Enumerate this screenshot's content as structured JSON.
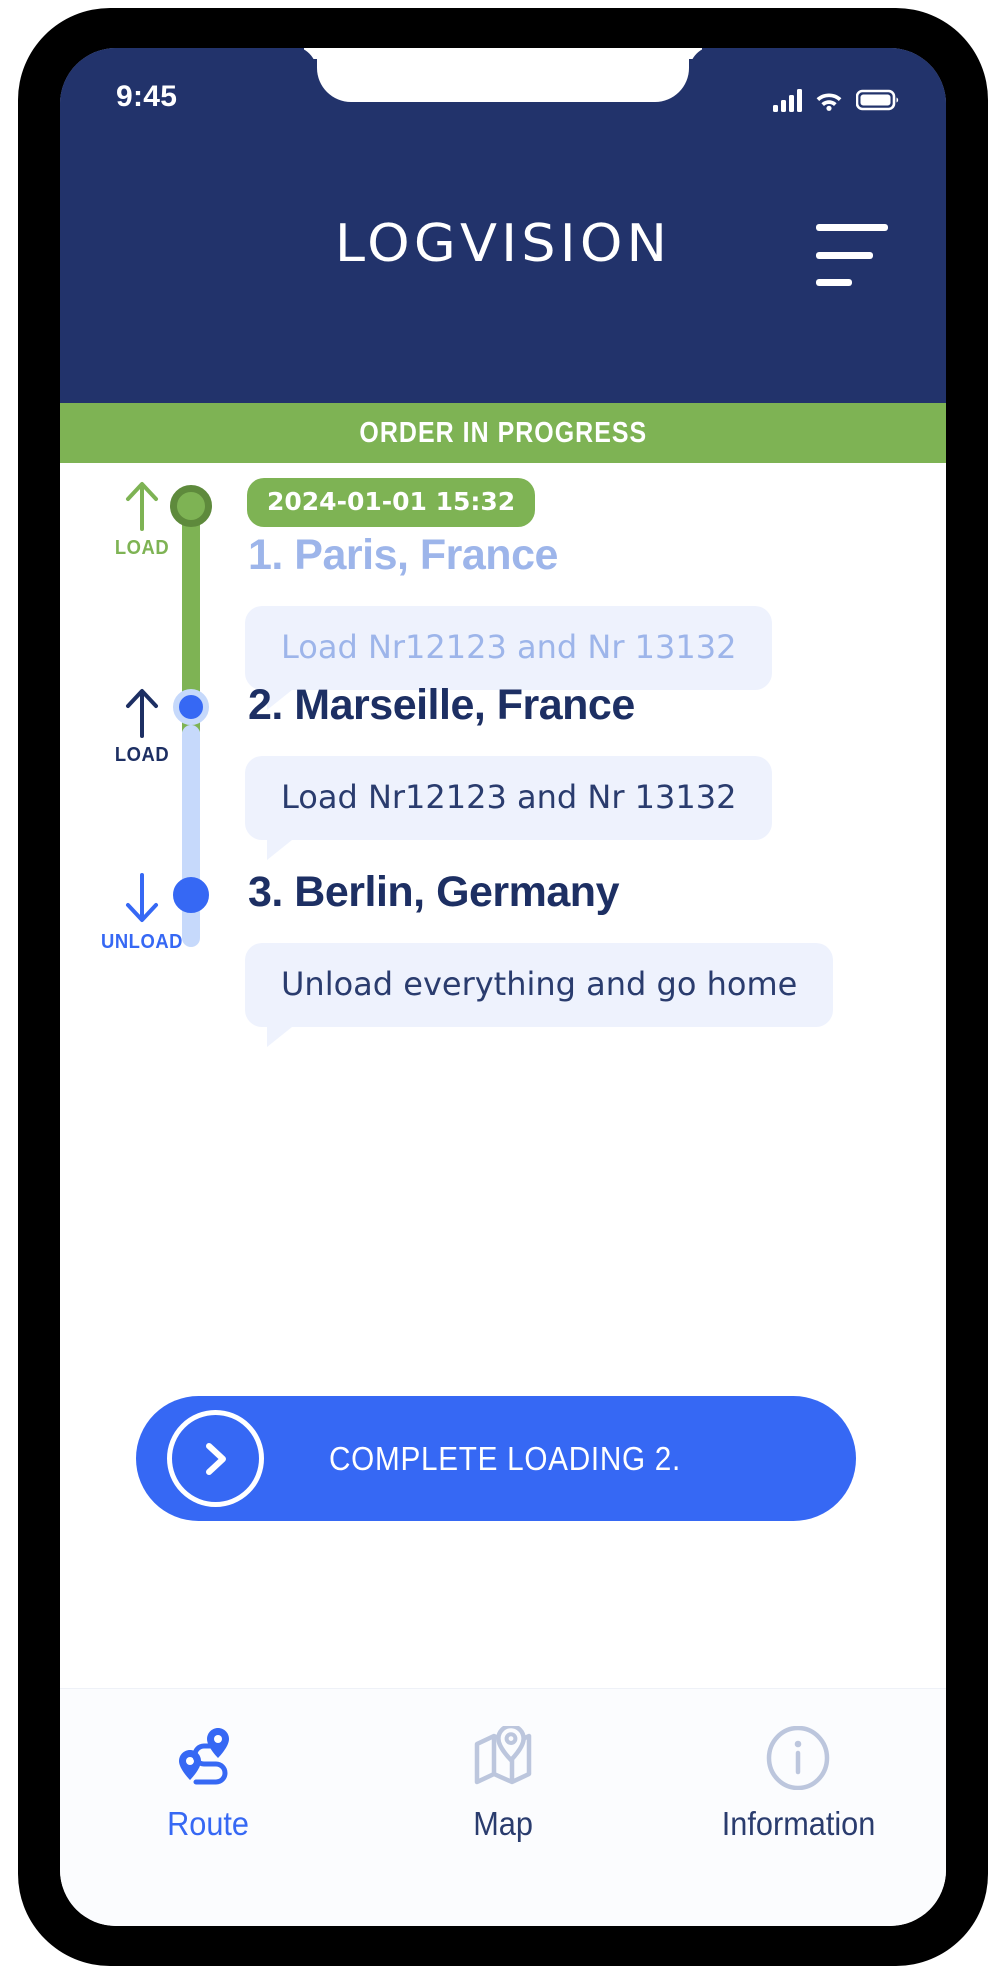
{
  "status_bar": {
    "time": "9:45",
    "signal_icon": "signal-bars-icon",
    "wifi_icon": "wifi-icon",
    "battery_icon": "battery-icon"
  },
  "header": {
    "brand": "LOGVISION",
    "menu_icon": "hamburger-menu-icon",
    "background_color": "#22336b"
  },
  "status_banner": {
    "text": "ORDER IN PROGRESS",
    "color": "#7eb354"
  },
  "timeline": {
    "stops": [
      {
        "index": "1.",
        "title": "1. Paris, France",
        "action": "LOAD",
        "action_icon": "arrow-up-icon",
        "timestamp": "2024-01-01  15:32",
        "note": "Load Nr12123 and Nr 13132",
        "state": "completed",
        "accent_color": "#7eb354"
      },
      {
        "index": "2.",
        "title": "2. Marseille, France",
        "action": "LOAD",
        "action_icon": "arrow-up-icon",
        "note": "Load Nr12123 and Nr 13132",
        "state": "active",
        "accent_color": "#3668f4"
      },
      {
        "index": "3.",
        "title": "3. Berlin, Germany",
        "action": "UNLOAD",
        "action_icon": "arrow-down-icon",
        "note": "Unload everything and go home",
        "state": "pending",
        "accent_color": "#3668f4"
      }
    ]
  },
  "cta": {
    "label": "COMPLETE LOADING 2.",
    "icon": "chevron-right-circle-icon",
    "color": "#3668f4"
  },
  "bottom_nav": {
    "items": [
      {
        "label": "Route",
        "icon": "route-pins-icon",
        "active": true
      },
      {
        "label": "Map",
        "icon": "map-pin-icon",
        "active": false
      },
      {
        "label": "Information",
        "icon": "info-circle-icon",
        "active": false
      }
    ]
  }
}
